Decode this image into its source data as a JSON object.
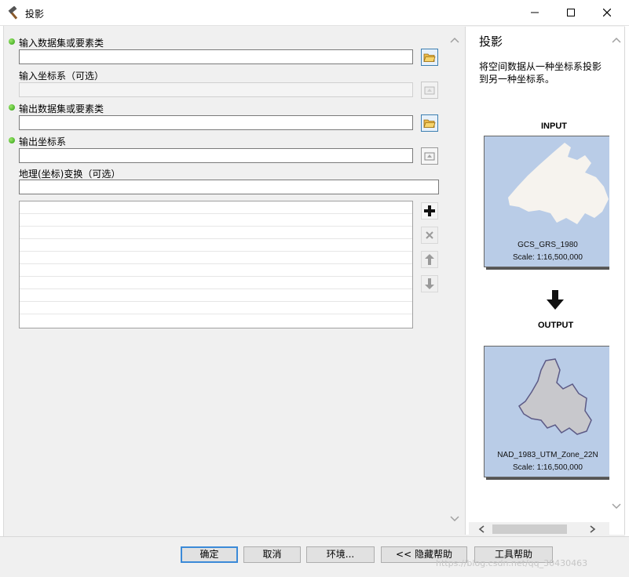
{
  "window": {
    "title": "投影"
  },
  "form": {
    "input_dataset_label": "输入数据集或要素类",
    "input_dataset_value": "",
    "input_cs_label": "输入坐标系（可选）",
    "input_cs_value": "",
    "output_dataset_label": "输出数据集或要素类",
    "output_dataset_value": "",
    "output_cs_label": "输出坐标系",
    "output_cs_value": "",
    "geo_transform_label": "地理(坐标)变换（可选）",
    "geo_transform_value": ""
  },
  "help": {
    "title": "投影",
    "description": "将空间数据从一种坐标系投影到另一种坐标系。",
    "input_header": "INPUT",
    "input_map_name": "GCS_GRS_1980",
    "input_map_scale": "Scale: 1:16,500,000",
    "output_header": "OUTPUT",
    "output_map_name": "NAD_1983_UTM_Zone_22N",
    "output_map_scale": "Scale: 1:16,500,000"
  },
  "buttons": {
    "ok": "确定",
    "cancel": "取消",
    "environments": "环境...",
    "hide_help": "<< 隐藏帮助",
    "tool_help": "工具帮助"
  },
  "watermark": "https://blog.csdn.net/qq_30430463",
  "colors": {
    "required_dot": "#2e9d12",
    "map_water": "#b9cce7",
    "default_button_border": "#3b8ad8"
  }
}
